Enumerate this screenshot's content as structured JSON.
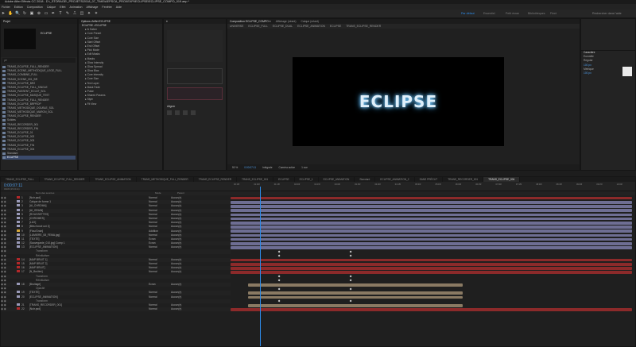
{
  "app_title": "Adobe After Effects CC 2018 - D:\\_STORAGE\\_PROJETS\\2018_07_TIME\\AEPSCA_PROXEXPI\\ECLIPSE\\ECLIPSE_COMPO_019.aep *",
  "menu": [
    "Fichier",
    "Edition",
    "Composition",
    "Calque",
    "Effet",
    "Animation",
    "Affichage",
    "Fenêtre",
    "Aide"
  ],
  "workspaces": {
    "items": [
      "Par défaut",
      "Essentiel",
      "Petit écran",
      "Bibliothèques",
      "Fleet"
    ],
    "active": "Par défaut"
  },
  "search_help": "Rechercher dans l'aide",
  "project": {
    "tab": "Projet",
    "search_placeholder": "ρ▾",
    "items": [
      "TRANS_ECLIPSE_FULL_RENDER",
      "TRANS_SCENE_METHODIQUE_LEGE_FULL",
      "TRANS_COMBINE_FULL",
      "TRANS_SCENE_001_BR",
      "TRANS_ECLIPSE_BR2",
      "TRANS_ECLIPSE_FULL_SINGLE",
      "TRANS_PASSENT_ECLAT_SOL",
      "TRANS_ECLIPSE_MASQUE_TEST",
      "TRANS_ECLIPSE_FULL_RENDER",
      "TRANS_ECLIPSE_BRPROP",
      "TRANS_METHODIQUE_DOUBLE_SOL",
      "TRANS_METHODIQUE_MARON_SOL",
      "TRANS_ECLIPSE_RENDER",
      "Solides",
      "TRANS_RECORDER_001",
      "TRANS_RECORDER_FIN",
      "TRANS_ECLIPSE_01",
      "TRANS_ECLIPSE_002",
      "TRANS_ECLIPSE_003",
      "TRANS_ECLIPSE_FIN",
      "TRANS_ECLIPSE_004",
      "Standard",
      "ECLIPSE"
    ],
    "selected": "ECLIPSE"
  },
  "effects": {
    "tab": "Options d'effet ECLIPSE",
    "header": "ECLIPSE • ÉCLIPSE",
    "items": [
      "fx Saber",
      "Core Preset",
      "Core Size",
      "Start Offset",
      "End Offset",
      "Pick Mode",
      "Edit Masks",
      "Masks",
      "Glow Intensity",
      "Glow Spread",
      "Glow Bias",
      "Core Intensity",
      "Core Size",
      "Text Layer",
      "Mask Fade",
      "Pulse",
      "Shared Params",
      "Style",
      "Fit View"
    ]
  },
  "character": {
    "tab": "Caractère",
    "font": "Eurostile",
    "style": "Regular",
    "size": "100 px",
    "tracking": "Métrique",
    "leading": "100 px"
  },
  "align": {
    "tab": "Aligner"
  },
  "comp": {
    "tabs": [
      "Composition ECLIPSE_COMPO ≡",
      "Affichage (néant)",
      "Calque (néant)"
    ],
    "breadcrumbs": [
      "UNIVERSE",
      "ECLIPSE_FULL",
      "ECLIPSE_DUAL",
      "ECLIPSE_ANIMATION",
      "ECLIPSE",
      "TRANS_ECLIPSE_RENDER"
    ],
    "title_text": "ECLIPSE",
    "zoom": "50 %",
    "resolution": "Intégrale",
    "camera": "Caméra active",
    "views": "1 vue",
    "timecode": "0:00:07:11"
  },
  "timeline": {
    "tabs": [
      "TRANS_ECLIPSE_FULL",
      "TRANS_ECLIPSE_FULL_RENDER",
      "TRANS_ECLIPSE_ANIMATION",
      "TRANS_METHODIQUE_FULL_RENDER",
      "TRANS_ECLIPSE_RENDER",
      "TRANS_ECLIPSE_001",
      "ECLIPSE",
      "ECLIPSE_1",
      "ECLIPSE_ANIMATION",
      "Standard",
      "ECLIPSE_ANIMATION_2",
      "SANS PRÉCUT",
      "TRANS_RECORDER_001",
      "TRANS_ECLIPSE_004"
    ],
    "active_tab": "TRANS_ECLIPSE_004",
    "timecode": "0:00:07:11",
    "fps": "00183 (25.00 i/s)",
    "col_name": "Nom des sources",
    "col_mode": "Mode",
    "col_parent": "Parent",
    "ruler": [
      "00:15f",
      "01:00f",
      "01:15f",
      "02:00f",
      "02:15f",
      "03:00f",
      "03:15f",
      "04:00f",
      "04:15f",
      "05:00f",
      "05:15f",
      "06:00f",
      "06:15f",
      "07:00f",
      "07:15f",
      "08:00f",
      "08:15f",
      "09:00f",
      "09:15f",
      "10:00f"
    ],
    "layers": [
      {
        "n": "1",
        "name": "[Noir.psd]",
        "mode": "Normal",
        "parent": "Aucun(e)",
        "color": "#b3282a"
      },
      {
        "n": "2",
        "name": "Calque de forme 1",
        "mode": "Normal",
        "parent": "Aucun(e)",
        "color": "#9a9ab8"
      },
      {
        "n": "3",
        "name": "[AI_CHROMA]",
        "mode": "Normal",
        "parent": "Aucun(e)",
        "color": "#9a9ab8"
      },
      {
        "n": "4",
        "name": "[AI_GRAIN]",
        "mode": "Normal",
        "parent": "Aucun(e)",
        "color": "#9a9ab8"
      },
      {
        "n": "5",
        "name": "[ROUSSETTES]",
        "mode": "Normal",
        "parent": "Aucun(e)",
        "color": "#9a9ab8"
      },
      {
        "n": "6",
        "name": "[CHROMES]",
        "mode": "Normal",
        "parent": "Aucun(e)",
        "color": "#9a9ab8"
      },
      {
        "n": "7",
        "name": "[LUX]",
        "mode": "Normal",
        "parent": "Aucun(e)",
        "color": "#9a9ab8"
      },
      {
        "n": "8",
        "name": "[Bleu foncé uni 2]",
        "mode": "Normal",
        "parent": "Aucun(e)",
        "color": "#9a9ab8"
      },
      {
        "n": "9",
        "name": "[Flou/Grain]",
        "mode": "Addition",
        "parent": "Aucun(e)",
        "color": "#d6a83a"
      },
      {
        "n": "10",
        "name": "[LUMIERE_08_FEMA.jpg]",
        "mode": "Normal",
        "parent": "Aucun(e)",
        "color": "#9a9ab8"
      },
      {
        "n": "11",
        "name": "[TEXTE]",
        "mode": "Ecran",
        "parent": "Aucun(e)",
        "color": "#9a9ab8"
      },
      {
        "n": "12",
        "name": "[Sauvegarde_010.jpg] Comp 1",
        "mode": "Ecran",
        "parent": "Aucun(e)",
        "color": "#9a9ab8"
      },
      {
        "n": "13",
        "name": "[ECLIPSE_ANIMATION]",
        "mode": "Normal",
        "parent": "Aucun(e)",
        "color": "#9a9ab8"
      },
      {
        "n": "",
        "name": "Transform",
        "mode": "",
        "parent": "",
        "color": ""
      },
      {
        "n": "",
        "name": "Réinitialiser",
        "mode": "",
        "parent": "",
        "color": ""
      },
      {
        "n": "14",
        "name": "[MAP BRUIT 1]",
        "mode": "Normal",
        "parent": "Aucun(e)",
        "color": "#b3282a"
      },
      {
        "n": "15",
        "name": "[MAP BRUIT 2]",
        "mode": "Normal",
        "parent": "Aucun(e)",
        "color": "#b3282a"
      },
      {
        "n": "16",
        "name": "[MAP BRUIT]",
        "mode": "Normal",
        "parent": "Aucun(e)",
        "color": "#b3282a"
      },
      {
        "n": "17",
        "name": "[N_Bruitée]",
        "mode": "Normal",
        "parent": "Aucun(e)",
        "color": "#b3282a"
      },
      {
        "n": "",
        "name": "Transform",
        "mode": "",
        "parent": "",
        "color": ""
      },
      {
        "n": "",
        "name": "Réinitialiser",
        "mode": "",
        "parent": "",
        "color": ""
      },
      {
        "n": "18",
        "name": "[Bruitage]",
        "mode": "Ecran",
        "parent": "Aucun(e)",
        "color": "#9a9ab8"
      },
      {
        "n": "",
        "name": "Opacité",
        "mode": "",
        "parent": "",
        "color": ""
      },
      {
        "n": "19",
        "name": "[TEXTE]",
        "mode": "Normal",
        "parent": "Aucun(e)",
        "color": "#9a9ab8"
      },
      {
        "n": "20",
        "name": "[ECLIPSE_ANIMATION]",
        "mode": "Normal",
        "parent": "Aucun(e)",
        "color": "#9a9ab8"
      },
      {
        "n": "",
        "name": "Transform",
        "mode": "",
        "parent": "",
        "color": ""
      },
      {
        "n": "21",
        "name": "[TRANS_RECORDER_001]",
        "mode": "Normal",
        "parent": "Aucun(e)",
        "color": "#9a9ab8"
      },
      {
        "n": "22",
        "name": "[Noir.psd]",
        "mode": "Normal",
        "parent": "Aucun(e)",
        "color": "#b3282a"
      }
    ]
  },
  "colors": {
    "accent": "#2d8ceb",
    "playhead": "#2d8ceb",
    "bar_purple": "#6e6e93",
    "bar_tan": "#8a7a63",
    "bar_red": "#8c2a2a"
  }
}
